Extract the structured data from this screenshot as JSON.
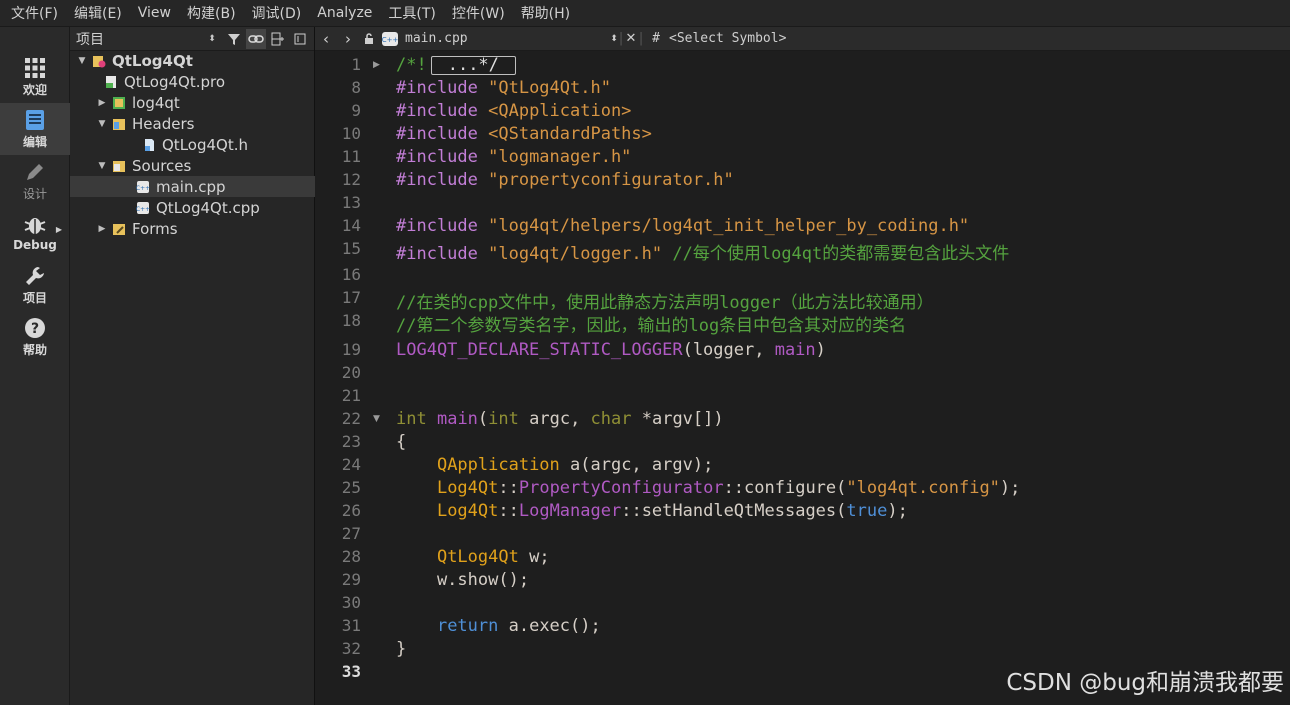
{
  "menu": [
    "文件(F)",
    "编辑(E)",
    "View",
    "构建(B)",
    "调试(D)",
    "Analyze",
    "工具(T)",
    "控件(W)",
    "帮助(H)"
  ],
  "modes": [
    {
      "label": "欢迎",
      "icon": "grid-icon"
    },
    {
      "label": "编辑",
      "icon": "document-icon"
    },
    {
      "label": "设计",
      "icon": "pencil-icon"
    },
    {
      "label": "Debug",
      "icon": "bug-icon"
    },
    {
      "label": "项目",
      "icon": "wrench-icon"
    },
    {
      "label": "帮助",
      "icon": "help-icon"
    }
  ],
  "project": {
    "title": "项目",
    "tree": [
      {
        "label": "QtLog4Qt",
        "icon": "project-icon"
      },
      {
        "label": "QtLog4Qt.pro",
        "icon": "pro-file-icon"
      },
      {
        "label": "log4qt",
        "icon": "subproject-icon"
      },
      {
        "label": "Headers",
        "icon": "folder-headers-icon"
      },
      {
        "label": "QtLog4Qt.h",
        "icon": "header-file-icon"
      },
      {
        "label": "Sources",
        "icon": "folder-sources-icon"
      },
      {
        "label": "main.cpp",
        "icon": "cpp-file-icon"
      },
      {
        "label": "QtLog4Qt.cpp",
        "icon": "cpp-file-icon"
      },
      {
        "label": "Forms",
        "icon": "folder-forms-icon"
      }
    ]
  },
  "editor": {
    "file_name": "main.cpp",
    "symbol": "<Select Symbol>",
    "hash": "#",
    "lines": [
      {
        "n": "1",
        "parts": [
          [
            "com",
            "/*!"
          ],
          [
            "box",
            "...*/"
          ]
        ]
      },
      {
        "n": "8",
        "parts": [
          [
            "pp",
            "#include "
          ],
          [
            "str",
            "\"QtLog4Qt.h\""
          ]
        ]
      },
      {
        "n": "9",
        "parts": [
          [
            "pp",
            "#include "
          ],
          [
            "str",
            "<QApplication>"
          ]
        ]
      },
      {
        "n": "10",
        "parts": [
          [
            "pp",
            "#include "
          ],
          [
            "str",
            "<QStandardPaths>"
          ]
        ]
      },
      {
        "n": "11",
        "parts": [
          [
            "pp",
            "#include "
          ],
          [
            "str",
            "\"logmanager.h\""
          ]
        ]
      },
      {
        "n": "12",
        "parts": [
          [
            "pp",
            "#include "
          ],
          [
            "str",
            "\"propertyconfigurator.h\""
          ]
        ]
      },
      {
        "n": "13",
        "parts": []
      },
      {
        "n": "14",
        "parts": [
          [
            "pp",
            "#include "
          ],
          [
            "str",
            "\"log4qt/helpers/log4qt_init_helper_by_coding.h\""
          ]
        ]
      },
      {
        "n": "15",
        "parts": [
          [
            "pp",
            "#include "
          ],
          [
            "str",
            "\"log4qt/logger.h\""
          ],
          [
            "txt",
            " "
          ],
          [
            "com",
            "//每个使用log4qt的类都需要包含此头文件"
          ]
        ]
      },
      {
        "n": "16",
        "parts": []
      },
      {
        "n": "17",
        "parts": [
          [
            "com",
            "//在类的cpp文件中，使用此静态方法声明logger（此方法比较通用）"
          ]
        ]
      },
      {
        "n": "18",
        "parts": [
          [
            "com",
            "//第二个参数写类名字，因此，输出的log条目中包含其对应的类名"
          ]
        ]
      },
      {
        "n": "19",
        "parts": [
          [
            "mac",
            "LOG4QT_DECLARE_STATIC_LOGGER"
          ],
          [
            "txt",
            "(logger, "
          ],
          [
            "mac",
            "main"
          ],
          [
            "txt",
            ")"
          ]
        ]
      },
      {
        "n": "20",
        "parts": []
      },
      {
        "n": "21",
        "parts": []
      },
      {
        "n": "22",
        "parts": [
          [
            "kw",
            "int"
          ],
          [
            "txt",
            " "
          ],
          [
            "mac",
            "main"
          ],
          [
            "txt",
            "("
          ],
          [
            "kw",
            "int"
          ],
          [
            "txt",
            " argc, "
          ],
          [
            "kw",
            "char"
          ],
          [
            "txt",
            " *argv[])"
          ]
        ]
      },
      {
        "n": "23",
        "parts": [
          [
            "txt",
            "{"
          ]
        ]
      },
      {
        "n": "24",
        "parts": [
          [
            "txt",
            "    "
          ],
          [
            "typ",
            "QApplication"
          ],
          [
            "txt",
            " a(argc, argv);"
          ]
        ]
      },
      {
        "n": "25",
        "parts": [
          [
            "txt",
            "    "
          ],
          [
            "typ",
            "Log4Qt"
          ],
          [
            "txt",
            "::"
          ],
          [
            "mac",
            "PropertyConfigurator"
          ],
          [
            "txt",
            "::configure("
          ],
          [
            "str",
            "\"log4qt.config\""
          ],
          [
            "txt",
            ");"
          ]
        ]
      },
      {
        "n": "26",
        "parts": [
          [
            "txt",
            "    "
          ],
          [
            "typ",
            "Log4Qt"
          ],
          [
            "txt",
            "::"
          ],
          [
            "mac",
            "LogManager"
          ],
          [
            "txt",
            "::setHandleQtMessages("
          ],
          [
            "kwb",
            "true"
          ],
          [
            "txt",
            ");"
          ]
        ]
      },
      {
        "n": "27",
        "parts": []
      },
      {
        "n": "28",
        "parts": [
          [
            "txt",
            "    "
          ],
          [
            "typ",
            "QtLog4Qt"
          ],
          [
            "txt",
            " w;"
          ]
        ]
      },
      {
        "n": "29",
        "parts": [
          [
            "txt",
            "    w.show();"
          ]
        ]
      },
      {
        "n": "30",
        "parts": []
      },
      {
        "n": "31",
        "parts": [
          [
            "txt",
            "    "
          ],
          [
            "kwb",
            "return"
          ],
          [
            "txt",
            " a.exec();"
          ]
        ]
      },
      {
        "n": "32",
        "parts": [
          [
            "txt",
            "}"
          ]
        ]
      },
      {
        "n": "33",
        "parts": []
      }
    ]
  },
  "watermark": "CSDN @bug和崩溃我都要",
  "colors": {
    "preprocessor": "#c27ed6",
    "string": "#d69545",
    "comment": "#55a33f",
    "keyword": "#8f8f35",
    "type": "#e0a11b",
    "function": "#b05ac3",
    "keyword_blue": "#4f8fd6"
  }
}
